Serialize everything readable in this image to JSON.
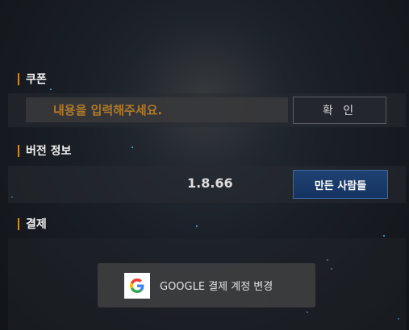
{
  "coupon": {
    "title": "쿠폰",
    "input_placeholder": "내용을 입력해주세요.",
    "confirm_label": "확 인"
  },
  "version": {
    "title": "버전 정보",
    "value": "1.8.66",
    "credits_label": "만든 사람들"
  },
  "payment": {
    "title": "결제",
    "google_button_label": "GOOGLE 결제 계정 변경",
    "google_icon": "google-g-icon"
  },
  "colors": {
    "accent_bar": "#d08a2a",
    "placeholder": "#b07a2a",
    "primary_button": "#1e4272"
  }
}
